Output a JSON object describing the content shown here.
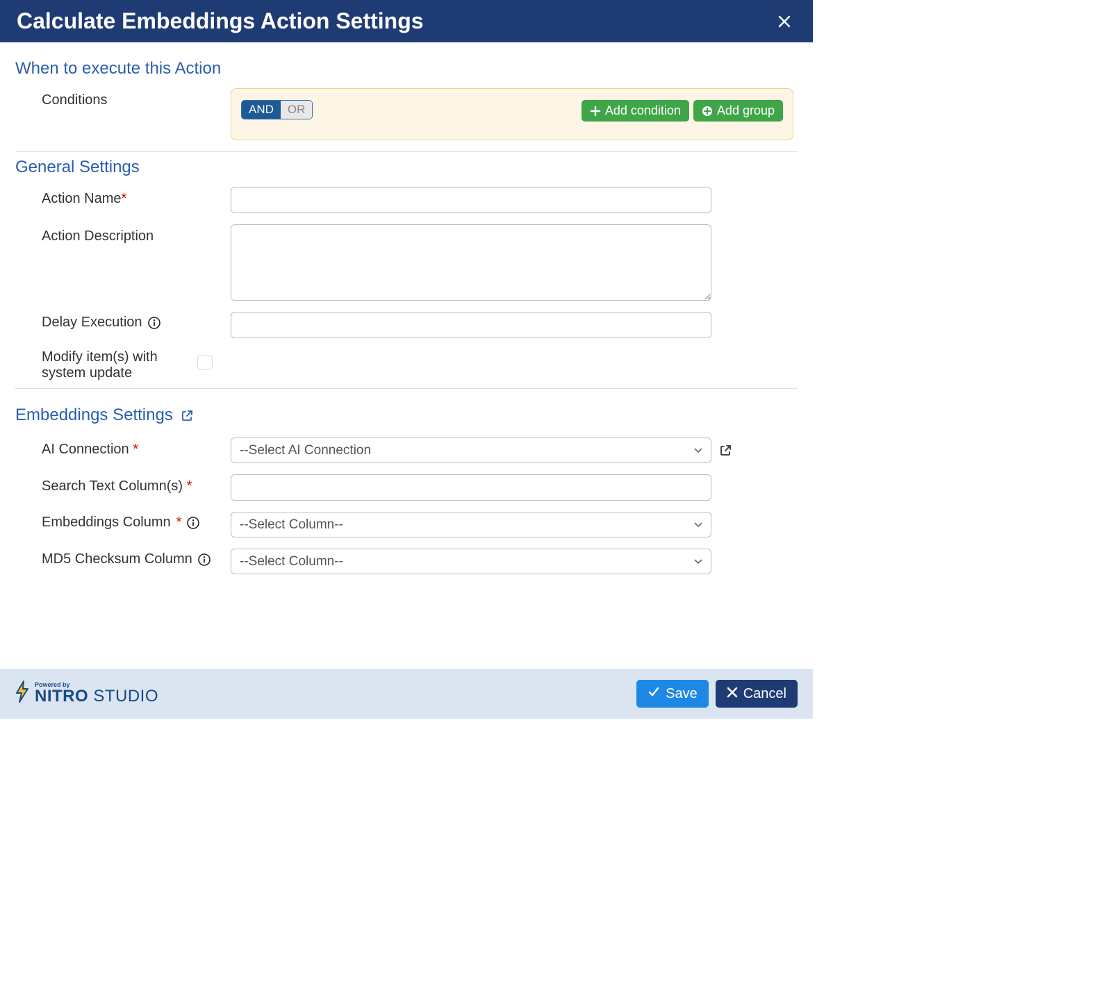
{
  "header": {
    "title": "Calculate Embeddings Action Settings"
  },
  "sections": {
    "when": {
      "title": "When to execute this Action",
      "conditions_label": "Conditions",
      "and_label": "AND",
      "or_label": "OR",
      "add_condition_label": "Add condition",
      "add_group_label": "Add group"
    },
    "general": {
      "title": "General Settings",
      "action_name_label": "Action Name",
      "action_description_label": "Action Description",
      "delay_execution_label": "Delay Execution",
      "modify_system_update_label": "Modify item(s) with system update"
    },
    "embeddings": {
      "title": "Embeddings Settings",
      "ai_connection_label": "AI Connection",
      "ai_connection_selected": "--Select AI Connection",
      "search_text_label": "Search Text Column(s)",
      "embeddings_column_label": "Embeddings Column",
      "embeddings_column_selected": "--Select Column--",
      "md5_label": "MD5 Checksum Column",
      "md5_selected": "--Select Column--"
    }
  },
  "footer": {
    "powered_by": "Powered by",
    "brand_bold": "NITRO",
    "brand_light": "STUDIO",
    "save_label": "Save",
    "cancel_label": "Cancel"
  },
  "required_mark": "*"
}
